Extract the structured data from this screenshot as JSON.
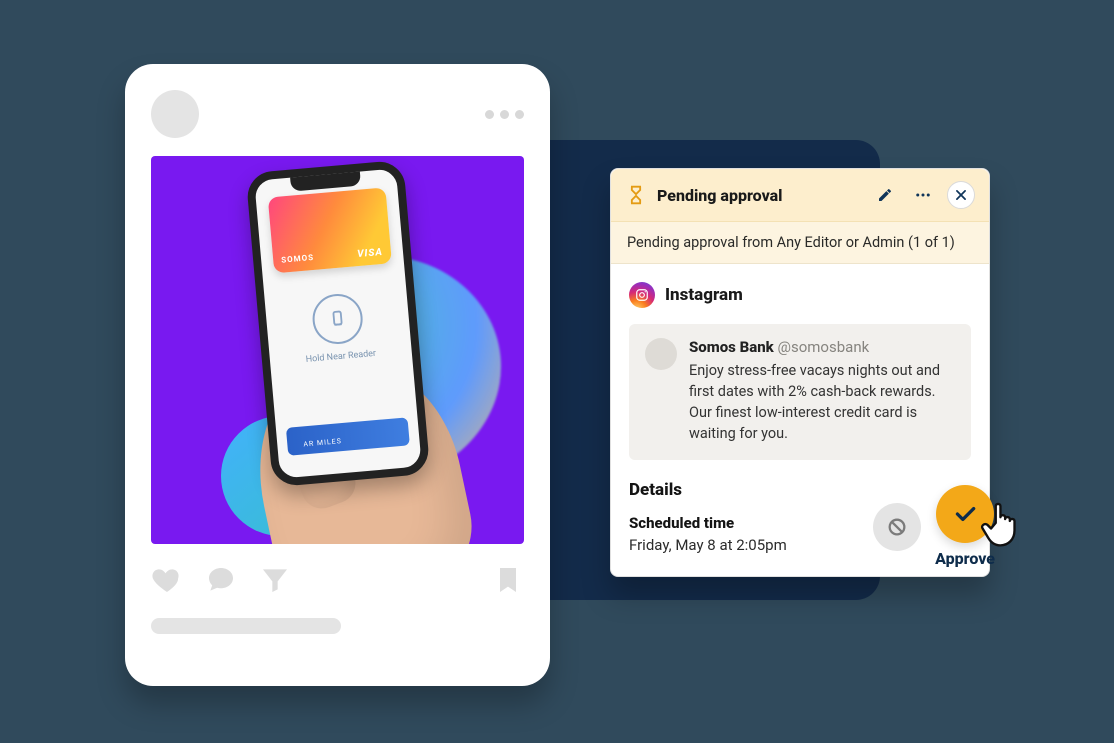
{
  "approval": {
    "header_title": "Pending approval",
    "subtext": "Pending approval from Any Editor or Admin (1 of 1)",
    "platform": "Instagram",
    "account_name": "Somos Bank",
    "account_handle": "@somosbank",
    "post_copy": "Enjoy stress-free vacays nights out and first dates with 2% cash-back rewards. Our finest low-interest credit card is waiting for you.",
    "details_title": "Details",
    "scheduled_label": "Scheduled time",
    "scheduled_value": "Friday, May 8 at 2:05pm",
    "approve_label": "Approve"
  },
  "phone": {
    "card_brand": "SOMOS",
    "card_network": "VISA",
    "nfc_text": "Hold Near Reader",
    "miles_label": "AR MILES"
  }
}
